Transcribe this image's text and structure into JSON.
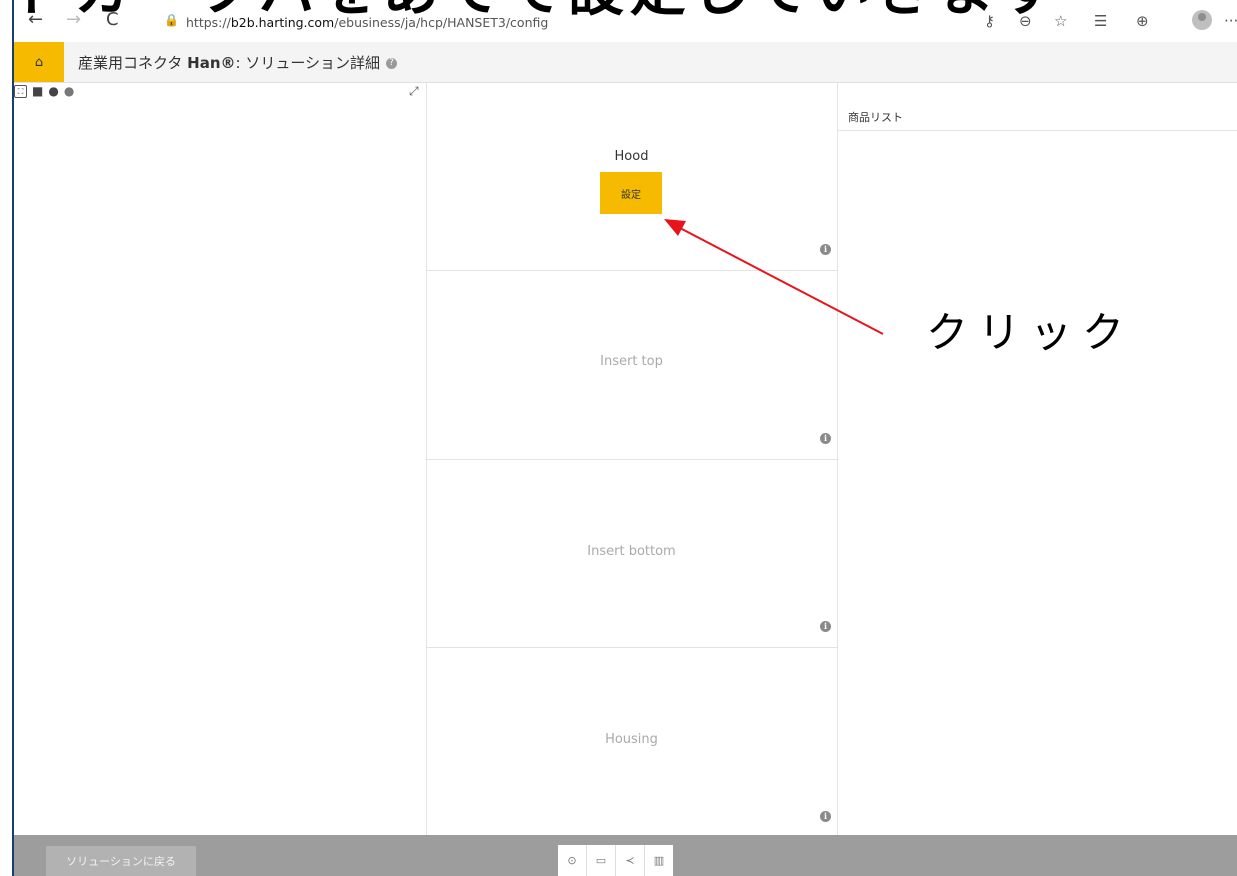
{
  "caption": {
    "text": "ドカーツバをあてて設定していきます"
  },
  "browser": {
    "back_icon": "←",
    "forward_icon": "→",
    "reload_icon": "C",
    "url_prefix": "https://",
    "url_host": "b2b.harting.com",
    "url_path": "/ebusiness/ja/hcp/HANSET3/config",
    "more_icon": "···"
  },
  "header": {
    "home_icon": "home-icon",
    "title_prefix": "産業用コネクタ ",
    "title_brand": "Han®",
    "title_suffix": ": ソリューション詳細",
    "help_icon": "?"
  },
  "slots": [
    {
      "label": "Hood",
      "active": true,
      "button_label": "設定"
    },
    {
      "label": "Insert top",
      "active": false
    },
    {
      "label": "Insert bottom",
      "active": false
    },
    {
      "label": "Housing",
      "active": false
    }
  ],
  "info_icon": "i",
  "product_list": {
    "title": "商品リスト"
  },
  "annotation": {
    "text": "クリック",
    "color": "#e8141c"
  },
  "footer": {
    "back_label": "ソリューションに戻る",
    "actions": [
      "upload-icon",
      "save-icon",
      "share-icon",
      "delete-icon"
    ]
  },
  "colors": {
    "accent": "#f6bb00",
    "footer": "#9d9d9d"
  }
}
